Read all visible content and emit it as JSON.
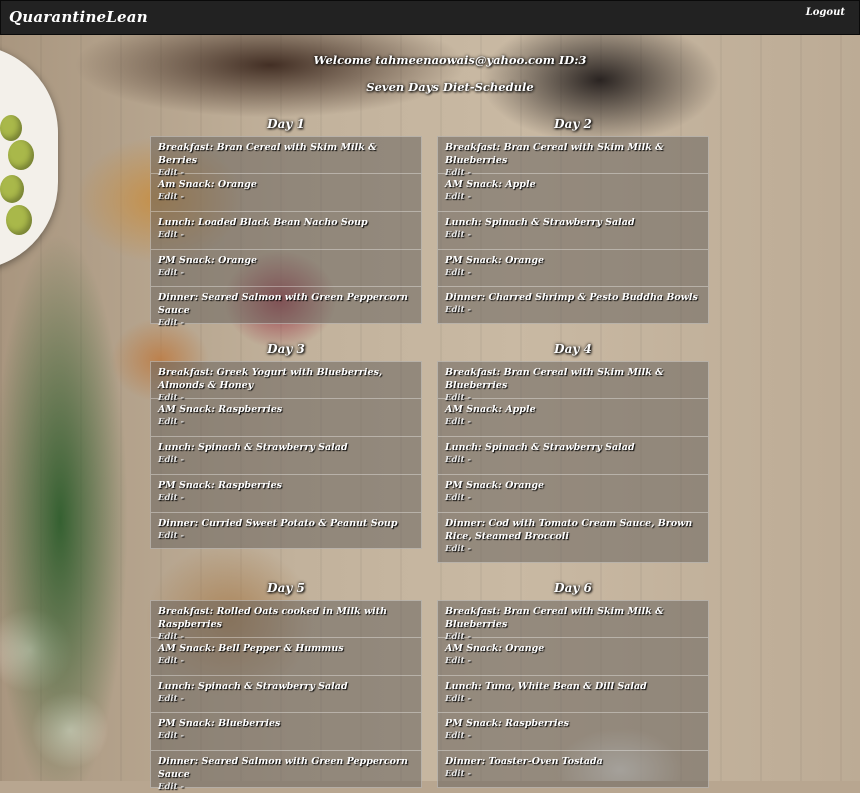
{
  "navbar": {
    "brand": "QuarantineLean",
    "logout": "Logout"
  },
  "welcome": "Welcome tahmeenaowais@yahoo.com ID:3",
  "subtitle": "Seven Days Diet-Schedule",
  "edit_label": "Edit",
  "edit_suffix": "-",
  "days": [
    {
      "title": "Day 1",
      "meals": [
        "Breakfast: Bran Cereal with Skim Milk & Berries",
        "Am Snack: Orange",
        "Lunch: Loaded Black Bean Nacho Soup",
        "PM Snack: Orange",
        "Dinner: Seared Salmon with Green Peppercorn Sauce"
      ]
    },
    {
      "title": "Day 2",
      "meals": [
        "Breakfast: Bran Cereal with Skim Milk & Blueberries",
        "AM Snack: Apple",
        "Lunch: Spinach & Strawberry Salad",
        "PM Snack: Orange",
        "Dinner: Charred Shrimp & Pesto Buddha Bowls"
      ]
    },
    {
      "title": "Day 3",
      "meals": [
        "Breakfast: Greek Yogurt with Blueberries, Almonds & Honey",
        "AM Snack: Raspberries",
        "Lunch: Spinach & Strawberry Salad",
        "PM Snack: Raspberries",
        "Dinner: Curried Sweet Potato & Peanut Soup"
      ]
    },
    {
      "title": "Day 4",
      "meals": [
        "Breakfast: Bran Cereal with Skim Milk & Blueberries",
        "AM Snack: Apple",
        "Lunch: Spinach & Strawberry Salad",
        "PM Snack: Orange",
        "Dinner: Cod with Tomato Cream Sauce, Brown Rice, Steamed Broccoli"
      ]
    },
    {
      "title": "Day 5",
      "meals": [
        "Breakfast: Rolled Oats cooked in Milk with Raspberries",
        "AM Snack: Bell Pepper & Hummus",
        "Lunch: Spinach & Strawberry Salad",
        "PM Snack: Blueberries",
        "Dinner: Seared Salmon with Green Peppercorn Sauce"
      ]
    },
    {
      "title": "Day 6",
      "meals": [
        "Breakfast: Bran Cereal with Skim Milk & Blueberries",
        "AM Snack: Orange",
        "Lunch: Tuna, White Bean & Dill Salad",
        "PM Snack: Raspberries",
        "Dinner: Toaster-Oven Tostada"
      ]
    }
  ]
}
